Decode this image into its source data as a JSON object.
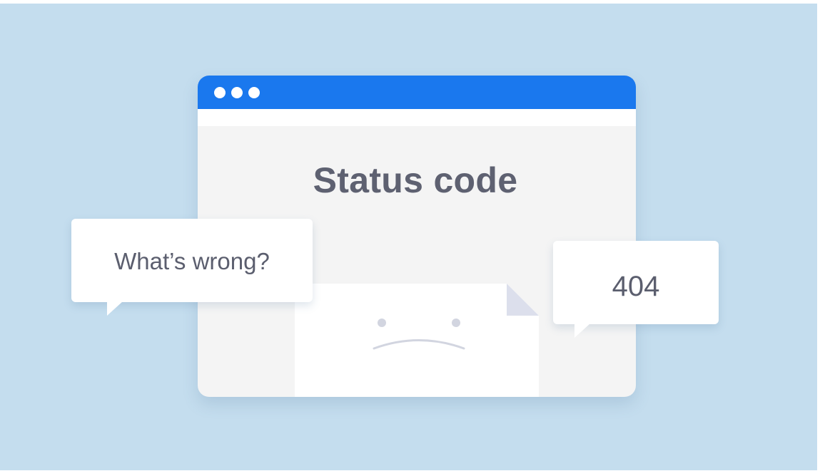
{
  "window": {
    "title": "Status code"
  },
  "bubbles": {
    "question": "What’s wrong?",
    "code": "404"
  },
  "colors": {
    "background": "#c4ddee",
    "title_bar": "#1a78ee",
    "window_body": "#f4f4f4",
    "text": "#5e6171",
    "fold": "#dcdfec"
  },
  "icons": {
    "window_controls": "three-white-dots",
    "document": "page-with-folded-corner",
    "face": "sad-face"
  }
}
